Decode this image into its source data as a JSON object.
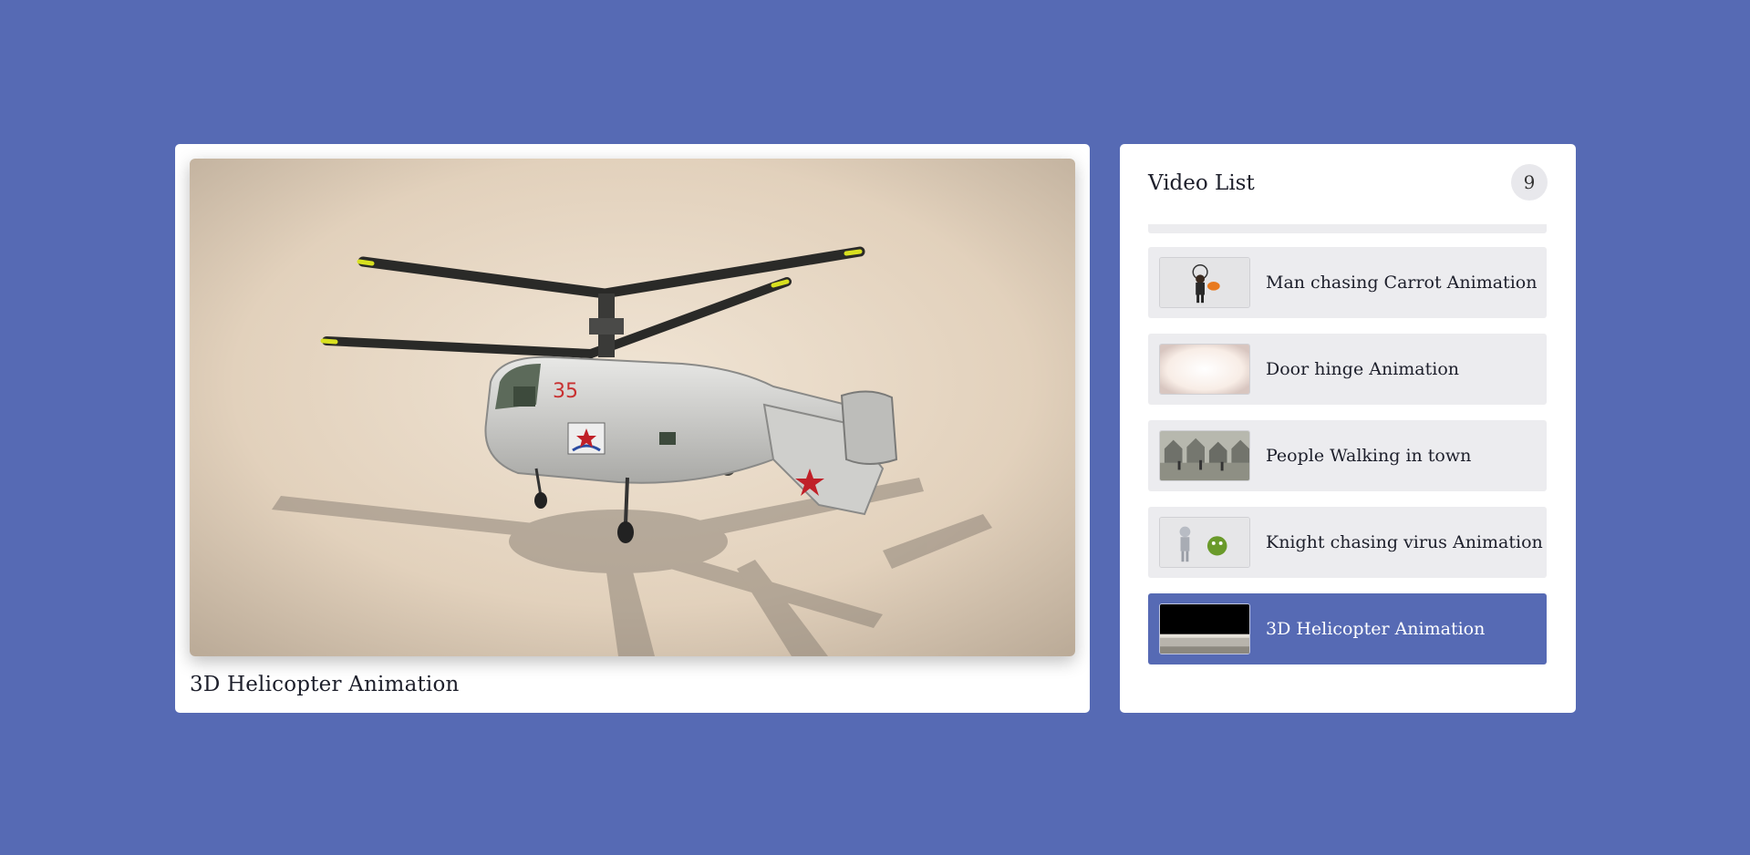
{
  "player": {
    "current_title": "3D Helicopter Animation",
    "helicopter_number": "35"
  },
  "video_list": {
    "heading": "Video List",
    "count": "9",
    "items": [
      {
        "label": "Man chasing Carrot Animation",
        "thumb": "man-carrot-thumbnail",
        "active": false
      },
      {
        "label": "Door hinge Animation",
        "thumb": "door-hinge-thumbnail",
        "active": false
      },
      {
        "label": "People Walking in town",
        "thumb": "people-town-thumbnail",
        "active": false
      },
      {
        "label": "Knight chasing virus Animation",
        "thumb": "knight-virus-thumbnail",
        "active": false
      },
      {
        "label": "3D Helicopter Animation",
        "thumb": "helicopter-thumbnail",
        "active": true
      }
    ]
  },
  "colors": {
    "background": "#566ab4",
    "card": "#ffffff",
    "item_bg": "#ececef",
    "active_item": "#566ab4"
  }
}
